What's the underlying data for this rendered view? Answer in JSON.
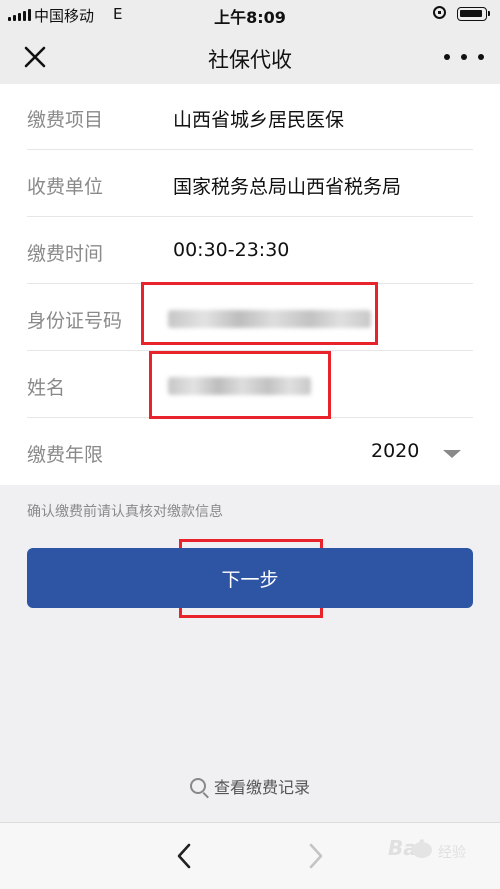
{
  "status_bar": {
    "carrier": "中国移动",
    "network": "E",
    "time": "上午8:09"
  },
  "nav": {
    "title": "社保代收",
    "close_icon": "close-icon",
    "more_icon": "more-icon"
  },
  "form": {
    "rows": [
      {
        "label": "缴费项目",
        "value": "山西省城乡居民医保"
      },
      {
        "label": "收费单位",
        "value": "国家税务总局山西省税务局"
      },
      {
        "label": "缴费时间",
        "value": "00:30-23:30"
      },
      {
        "label": "身份证号码",
        "value": ""
      },
      {
        "label": "姓名",
        "value": ""
      },
      {
        "label": "缴费年限",
        "value": "2020"
      }
    ],
    "hint": "确认缴费前请认真核对缴款信息"
  },
  "next_button": {
    "label": "下一步"
  },
  "records_link": {
    "label": "查看缴费记录",
    "icon": "search-icon"
  },
  "bottom_nav": {
    "back_icon": "chevron-left-icon",
    "forward_icon": "chevron-right-icon"
  },
  "watermark": {
    "text_left": "Bai",
    "text_right": "经验"
  },
  "colors": {
    "primary_button": "#2d55a3",
    "highlight_box": "#e8232b",
    "label_gray": "#8a8a8a",
    "page_background": "#f0f0f2"
  }
}
